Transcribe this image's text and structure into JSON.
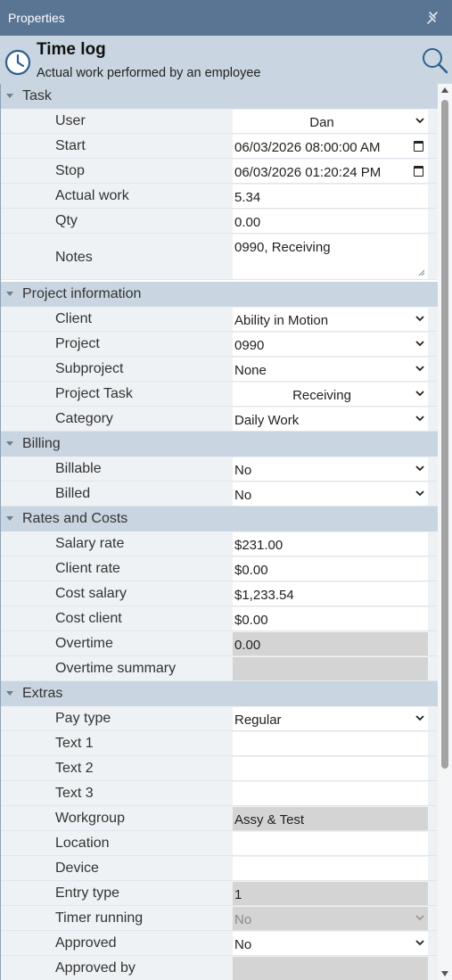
{
  "panel": {
    "title": "Properties"
  },
  "header": {
    "title": "Time log",
    "subtitle": "Actual work performed by an employee"
  },
  "sections": {
    "task": "Task",
    "project": "Project information",
    "billing": "Billing",
    "rates": "Rates and Costs",
    "extras": "Extras"
  },
  "fields": {
    "user": {
      "label": "User",
      "value": "Dan"
    },
    "start": {
      "label": "Start",
      "value": "06/03/2026 08:00:00 AM"
    },
    "stop": {
      "label": "Stop",
      "value": "06/03/2026 01:20:24 PM"
    },
    "actual_work": {
      "label": "Actual work",
      "value": "5.34"
    },
    "qty": {
      "label": "Qty",
      "value": "0.00"
    },
    "notes": {
      "label": "Notes",
      "value": "0990, Receiving"
    },
    "client": {
      "label": "Client",
      "value": "Ability in Motion"
    },
    "project": {
      "label": "Project",
      "value": "0990"
    },
    "subproject": {
      "label": "Subproject",
      "value": "None"
    },
    "project_task": {
      "label": "Project Task",
      "value": "Receiving"
    },
    "category": {
      "label": "Category",
      "value": "Daily Work"
    },
    "billable": {
      "label": "Billable",
      "value": "No"
    },
    "billed": {
      "label": "Billed",
      "value": "No"
    },
    "salary_rate": {
      "label": "Salary rate",
      "value": "$231.00"
    },
    "client_rate": {
      "label": "Client rate",
      "value": "$0.00"
    },
    "cost_salary": {
      "label": "Cost salary",
      "value": "$1,233.54"
    },
    "cost_client": {
      "label": "Cost client",
      "value": "$0.00"
    },
    "overtime": {
      "label": "Overtime",
      "value": "0.00"
    },
    "overtime_summary": {
      "label": "Overtime summary",
      "value": ""
    },
    "pay_type": {
      "label": "Pay type",
      "value": "Regular"
    },
    "text1": {
      "label": "Text 1",
      "value": ""
    },
    "text2": {
      "label": "Text 2",
      "value": ""
    },
    "text3": {
      "label": "Text 3",
      "value": ""
    },
    "workgroup": {
      "label": "Workgroup",
      "value": "Assy & Test"
    },
    "location": {
      "label": "Location",
      "value": ""
    },
    "device": {
      "label": "Device",
      "value": ""
    },
    "entry_type": {
      "label": "Entry type",
      "value": "1"
    },
    "timer_running": {
      "label": "Timer running",
      "value": "No"
    },
    "approved": {
      "label": "Approved",
      "value": "No"
    },
    "approved_by": {
      "label": "Approved by",
      "value": ""
    }
  },
  "icons": {
    "pin": "pin-icon",
    "clock": "clock-icon",
    "search": "search-icon",
    "expand": "chevron-down-icon",
    "calendar": "calendar-icon"
  },
  "colors": {
    "titlebar": "#5a7494",
    "header": "#c9d6e1",
    "row": "#eef2f5",
    "readonly": "#d4d4d4"
  }
}
